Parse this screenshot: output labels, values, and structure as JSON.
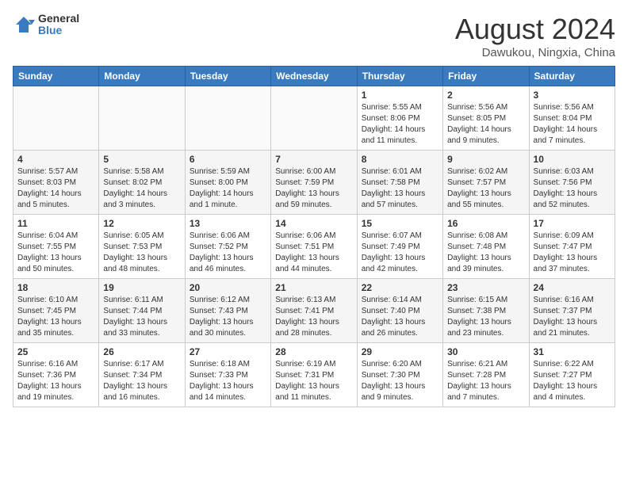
{
  "header": {
    "logo_general": "General",
    "logo_blue": "Blue",
    "month": "August 2024",
    "location": "Dawukou, Ningxia, China"
  },
  "weekdays": [
    "Sunday",
    "Monday",
    "Tuesday",
    "Wednesday",
    "Thursday",
    "Friday",
    "Saturday"
  ],
  "weeks": [
    [
      {
        "day": "",
        "info": ""
      },
      {
        "day": "",
        "info": ""
      },
      {
        "day": "",
        "info": ""
      },
      {
        "day": "",
        "info": ""
      },
      {
        "day": "1",
        "info": "Sunrise: 5:55 AM\nSunset: 8:06 PM\nDaylight: 14 hours\nand 11 minutes."
      },
      {
        "day": "2",
        "info": "Sunrise: 5:56 AM\nSunset: 8:05 PM\nDaylight: 14 hours\nand 9 minutes."
      },
      {
        "day": "3",
        "info": "Sunrise: 5:56 AM\nSunset: 8:04 PM\nDaylight: 14 hours\nand 7 minutes."
      }
    ],
    [
      {
        "day": "4",
        "info": "Sunrise: 5:57 AM\nSunset: 8:03 PM\nDaylight: 14 hours\nand 5 minutes."
      },
      {
        "day": "5",
        "info": "Sunrise: 5:58 AM\nSunset: 8:02 PM\nDaylight: 14 hours\nand 3 minutes."
      },
      {
        "day": "6",
        "info": "Sunrise: 5:59 AM\nSunset: 8:00 PM\nDaylight: 14 hours\nand 1 minute."
      },
      {
        "day": "7",
        "info": "Sunrise: 6:00 AM\nSunset: 7:59 PM\nDaylight: 13 hours\nand 59 minutes."
      },
      {
        "day": "8",
        "info": "Sunrise: 6:01 AM\nSunset: 7:58 PM\nDaylight: 13 hours\nand 57 minutes."
      },
      {
        "day": "9",
        "info": "Sunrise: 6:02 AM\nSunset: 7:57 PM\nDaylight: 13 hours\nand 55 minutes."
      },
      {
        "day": "10",
        "info": "Sunrise: 6:03 AM\nSunset: 7:56 PM\nDaylight: 13 hours\nand 52 minutes."
      }
    ],
    [
      {
        "day": "11",
        "info": "Sunrise: 6:04 AM\nSunset: 7:55 PM\nDaylight: 13 hours\nand 50 minutes."
      },
      {
        "day": "12",
        "info": "Sunrise: 6:05 AM\nSunset: 7:53 PM\nDaylight: 13 hours\nand 48 minutes."
      },
      {
        "day": "13",
        "info": "Sunrise: 6:06 AM\nSunset: 7:52 PM\nDaylight: 13 hours\nand 46 minutes."
      },
      {
        "day": "14",
        "info": "Sunrise: 6:06 AM\nSunset: 7:51 PM\nDaylight: 13 hours\nand 44 minutes."
      },
      {
        "day": "15",
        "info": "Sunrise: 6:07 AM\nSunset: 7:49 PM\nDaylight: 13 hours\nand 42 minutes."
      },
      {
        "day": "16",
        "info": "Sunrise: 6:08 AM\nSunset: 7:48 PM\nDaylight: 13 hours\nand 39 minutes."
      },
      {
        "day": "17",
        "info": "Sunrise: 6:09 AM\nSunset: 7:47 PM\nDaylight: 13 hours\nand 37 minutes."
      }
    ],
    [
      {
        "day": "18",
        "info": "Sunrise: 6:10 AM\nSunset: 7:45 PM\nDaylight: 13 hours\nand 35 minutes."
      },
      {
        "day": "19",
        "info": "Sunrise: 6:11 AM\nSunset: 7:44 PM\nDaylight: 13 hours\nand 33 minutes."
      },
      {
        "day": "20",
        "info": "Sunrise: 6:12 AM\nSunset: 7:43 PM\nDaylight: 13 hours\nand 30 minutes."
      },
      {
        "day": "21",
        "info": "Sunrise: 6:13 AM\nSunset: 7:41 PM\nDaylight: 13 hours\nand 28 minutes."
      },
      {
        "day": "22",
        "info": "Sunrise: 6:14 AM\nSunset: 7:40 PM\nDaylight: 13 hours\nand 26 minutes."
      },
      {
        "day": "23",
        "info": "Sunrise: 6:15 AM\nSunset: 7:38 PM\nDaylight: 13 hours\nand 23 minutes."
      },
      {
        "day": "24",
        "info": "Sunrise: 6:16 AM\nSunset: 7:37 PM\nDaylight: 13 hours\nand 21 minutes."
      }
    ],
    [
      {
        "day": "25",
        "info": "Sunrise: 6:16 AM\nSunset: 7:36 PM\nDaylight: 13 hours\nand 19 minutes."
      },
      {
        "day": "26",
        "info": "Sunrise: 6:17 AM\nSunset: 7:34 PM\nDaylight: 13 hours\nand 16 minutes."
      },
      {
        "day": "27",
        "info": "Sunrise: 6:18 AM\nSunset: 7:33 PM\nDaylight: 13 hours\nand 14 minutes."
      },
      {
        "day": "28",
        "info": "Sunrise: 6:19 AM\nSunset: 7:31 PM\nDaylight: 13 hours\nand 11 minutes."
      },
      {
        "day": "29",
        "info": "Sunrise: 6:20 AM\nSunset: 7:30 PM\nDaylight: 13 hours\nand 9 minutes."
      },
      {
        "day": "30",
        "info": "Sunrise: 6:21 AM\nSunset: 7:28 PM\nDaylight: 13 hours\nand 7 minutes."
      },
      {
        "day": "31",
        "info": "Sunrise: 6:22 AM\nSunset: 7:27 PM\nDaylight: 13 hours\nand 4 minutes."
      }
    ]
  ]
}
